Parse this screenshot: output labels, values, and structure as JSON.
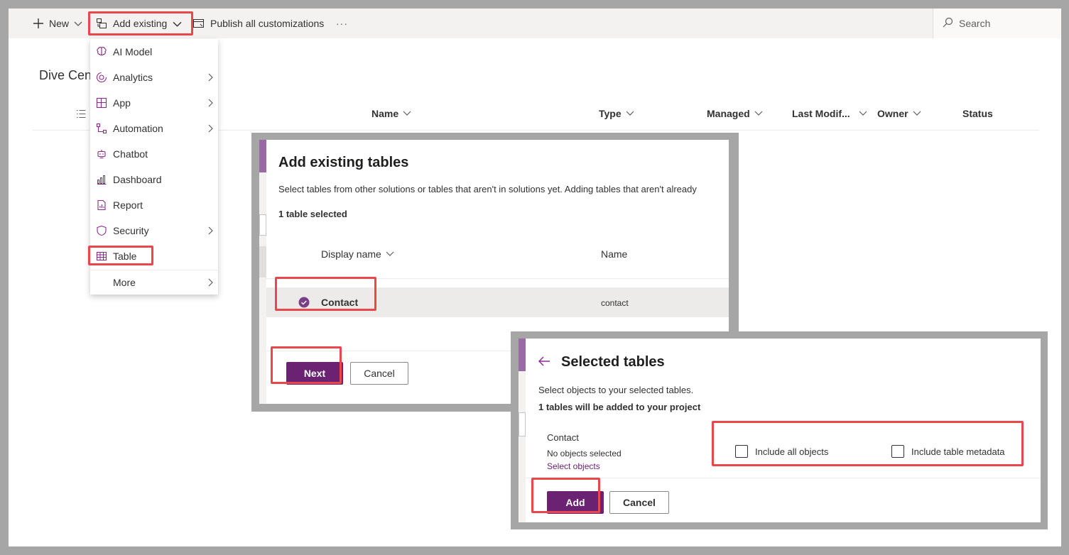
{
  "toolbar": {
    "new_label": "New",
    "add_existing_label": "Add existing",
    "publish_label": "Publish all customizations",
    "more_label": "···",
    "search_label": "Search"
  },
  "page": {
    "title": "Dive Cen"
  },
  "columns": {
    "name": "Name",
    "type": "Type",
    "managed": "Managed",
    "last_modified": "Last Modif...",
    "owner": "Owner",
    "status": "Status"
  },
  "menu": {
    "items": [
      {
        "label": "AI Model",
        "icon": "ai-model-icon",
        "submenu": false
      },
      {
        "label": "Analytics",
        "icon": "analytics-icon",
        "submenu": true
      },
      {
        "label": "App",
        "icon": "app-icon",
        "submenu": true
      },
      {
        "label": "Automation",
        "icon": "automation-icon",
        "submenu": true
      },
      {
        "label": "Chatbot",
        "icon": "chatbot-icon",
        "submenu": false
      },
      {
        "label": "Dashboard",
        "icon": "dashboard-icon",
        "submenu": false
      },
      {
        "label": "Report",
        "icon": "report-icon",
        "submenu": false
      },
      {
        "label": "Security",
        "icon": "shield-icon",
        "submenu": true
      },
      {
        "label": "Table",
        "icon": "table-icon",
        "submenu": false
      },
      {
        "label": "More",
        "icon": "",
        "submenu": true
      }
    ]
  },
  "dialog_tables": {
    "title": "Add existing tables",
    "description": "Select tables from other solutions or tables that aren't in solutions yet. Adding tables that aren't already",
    "selected_count": "1 table selected",
    "col_display_name": "Display name",
    "col_name": "Name",
    "rows": [
      {
        "display_name": "Contact",
        "name": "contact",
        "selected": true
      }
    ],
    "next_label": "Next",
    "cancel_label": "Cancel"
  },
  "dialog_selected": {
    "title": "Selected tables",
    "description": "Select objects to your selected tables.",
    "count_text": "1 tables will be added to your project",
    "table_name": "Contact",
    "objects_status": "No objects selected",
    "select_objects_link": "Select objects",
    "include_all_label": "Include all objects",
    "include_metadata_label": "Include table metadata",
    "add_label": "Add",
    "cancel_label": "Cancel"
  },
  "colors": {
    "accent": "#6b2273",
    "highlight": "#e8474c",
    "menu_icon": "#8a2a8e"
  }
}
